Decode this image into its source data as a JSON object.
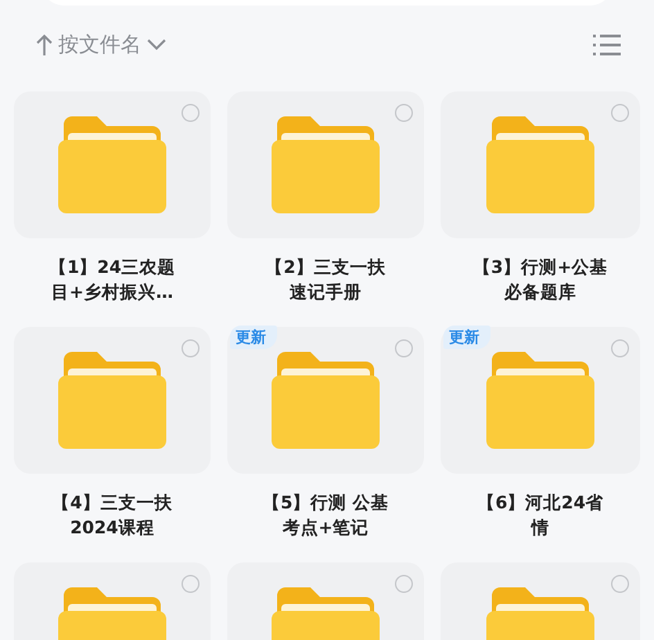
{
  "sort": {
    "label": "按文件名"
  },
  "folders": [
    {
      "name_lines": [
        "【1】24三农题",
        "目+乡村振兴…"
      ],
      "selected": false
    },
    {
      "name_lines": [
        "【2】三支一扶",
        "速记手册"
      ],
      "selected": false
    },
    {
      "name_lines": [
        "【3】行测+公基",
        "必备题库"
      ],
      "selected": false
    },
    {
      "name_lines": [
        "【4】三支一扶",
        "2024课程"
      ],
      "selected": false
    },
    {
      "name_lines": [
        "【5】行测 公基",
        "考点+笔记"
      ],
      "badge": "更新",
      "selected": false
    },
    {
      "name_lines": [
        "【6】河北24省",
        "情"
      ],
      "badge": "更新",
      "selected": false
    },
    {
      "selected": false
    },
    {
      "selected": false
    },
    {
      "selected": false
    }
  ]
}
